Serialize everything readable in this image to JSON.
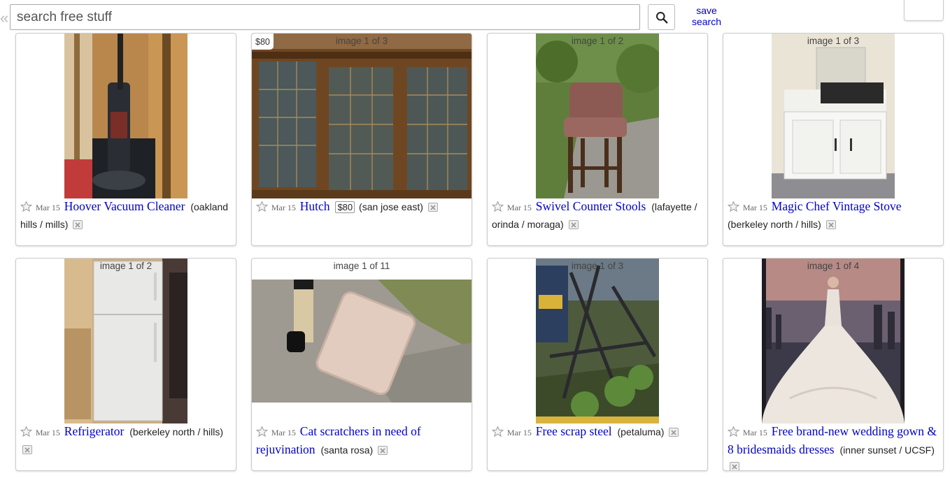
{
  "search": {
    "placeholder": "search free stuff"
  },
  "save_search": {
    "line1": "save",
    "line2": "search"
  },
  "icons": {
    "collapse": "double-chevron-left",
    "search": "magnifier",
    "favorite": "star-outline",
    "hide": "hide-box-icon"
  },
  "colors": {
    "link": "#0000cc",
    "border": "#cccccc"
  },
  "listings": [
    {
      "image_count": "",
      "price_tag": "",
      "date": "Mar 15",
      "title": "Hoover Vacuum Cleaner",
      "price": "",
      "hood": "(oakland hills / mills)"
    },
    {
      "image_count": "image 1 of 3",
      "price_tag": "$80",
      "date": "Mar 15",
      "title": "Hutch",
      "price": "$80",
      "hood": "(san jose east)"
    },
    {
      "image_count": "image 1 of 2",
      "price_tag": "",
      "date": "Mar 15",
      "title": "Swivel Counter Stools",
      "price": "",
      "hood": "(lafayette / orinda / moraga)"
    },
    {
      "image_count": "image 1 of 3",
      "price_tag": "",
      "date": "Mar 15",
      "title": "Magic Chef Vintage Stove",
      "price": "",
      "hood": "(berkeley north / hills)"
    },
    {
      "image_count": "image 1 of 2",
      "price_tag": "",
      "date": "Mar 15",
      "title": "Refrigerator",
      "price": "",
      "hood": "(berkeley north / hills)"
    },
    {
      "image_count": "image 1 of 11",
      "price_tag": "",
      "date": "Mar 15",
      "title": "Cat scratchers in need of rejuvination",
      "price": "",
      "hood": "(santa rosa)"
    },
    {
      "image_count": "image 1 of 3",
      "price_tag": "",
      "date": "Mar 15",
      "title": "Free scrap steel",
      "price": "",
      "hood": "(petaluma)"
    },
    {
      "image_count": "image 1 of 4",
      "price_tag": "",
      "date": "Mar 15",
      "title": "Free brand-new wedding gown & 8 bridesmaids dresses",
      "price": "",
      "hood": "(inner sunset / UCSF)"
    }
  ]
}
